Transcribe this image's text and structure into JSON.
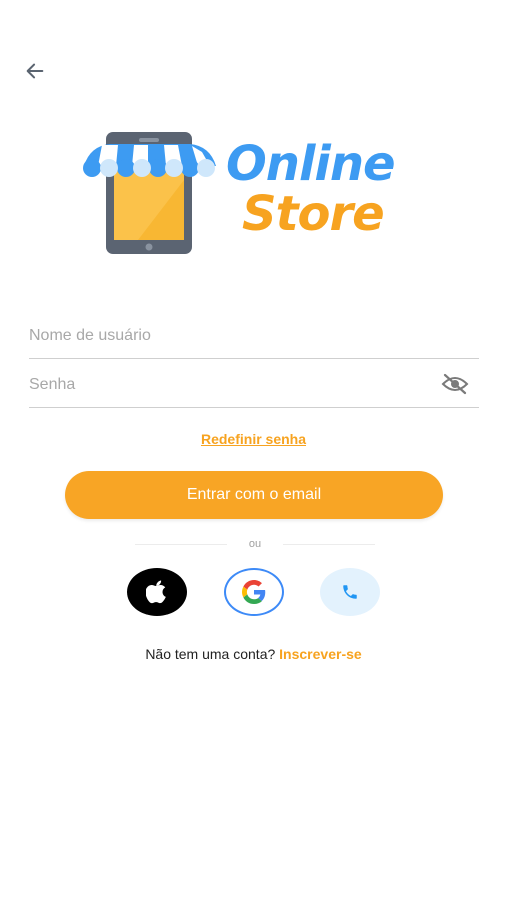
{
  "navigation": {
    "back_icon": "arrow-left-icon"
  },
  "logo": {
    "line1": "Online",
    "line2": "Store",
    "icon": "phone-store-awning-icon"
  },
  "form": {
    "username_placeholder": "Nome de usuário",
    "password_placeholder": "Senha",
    "password_toggle_icon": "eye-off-icon",
    "reset_link": "Redefinir senha",
    "submit_label": "Entrar com o email"
  },
  "divider": {
    "text": "ou"
  },
  "social": {
    "apple_icon": "apple-icon",
    "google_icon": "google-icon",
    "phone_icon": "phone-icon"
  },
  "signup": {
    "prompt": "Não tem uma conta? ",
    "link": "Inscrever-se"
  },
  "colors": {
    "accent": "#f8a525",
    "brand_blue": "#3d9bf2",
    "phone_bg": "#e3f2fd"
  }
}
